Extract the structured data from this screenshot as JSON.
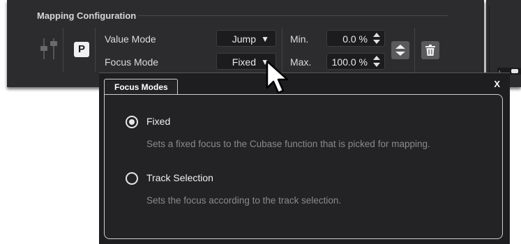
{
  "section": {
    "title": "Mapping Configuration"
  },
  "mapping": {
    "p_button_label": "P",
    "value_mode": {
      "label": "Value Mode",
      "selected": "Jump"
    },
    "focus_mode": {
      "label": "Focus Mode",
      "selected": "Fixed"
    },
    "min": {
      "label": "Min.",
      "value": "0.0 %"
    },
    "max": {
      "label": "Max.",
      "value": "100.0 %"
    },
    "caret_glyph": "▼"
  },
  "icons": {
    "fader": "fader-icon",
    "swap": "up-down-arrows-icon",
    "delete": "trash-icon",
    "cursor": "mouse-pointer-icon"
  },
  "right_strip": {
    "knob_tick": "‹"
  },
  "popup": {
    "tab_label": "Focus Modes",
    "close_label": "X",
    "options": [
      {
        "label": "Fixed",
        "checked": true,
        "description": "Sets a fixed focus to the Cubase function that is picked for mapping."
      },
      {
        "label": "Track Selection",
        "checked": false,
        "description": "Sets the focus according to the track selection."
      }
    ]
  },
  "colors": {
    "panel_bg": "#2c2c2e",
    "popup_bg": "#232325",
    "field_bg": "#1c1c1e",
    "icon_button_bg": "#5a5a5c",
    "text_primary": "#e6e6e6",
    "text_muted": "#8a8a8c"
  }
}
